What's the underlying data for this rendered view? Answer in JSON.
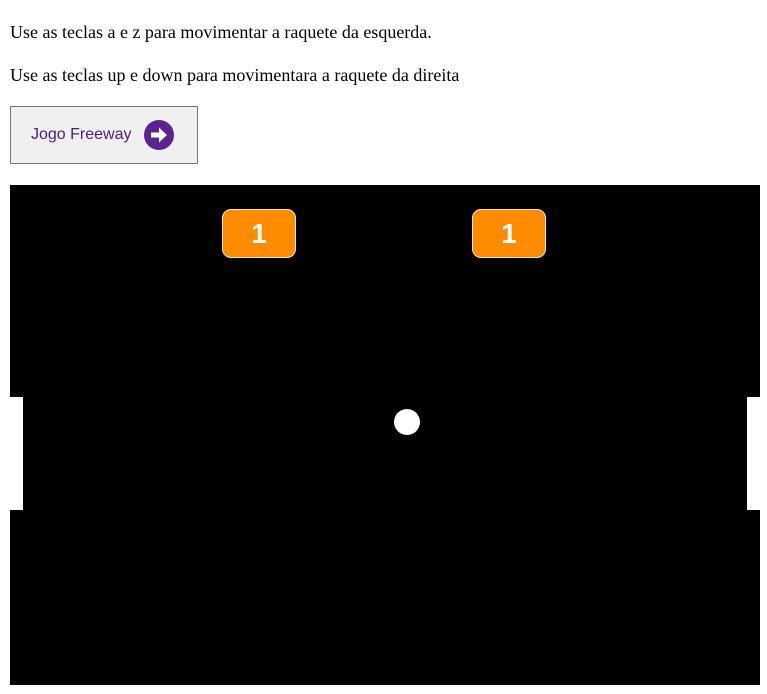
{
  "instructions": {
    "left_paddle": "Use as teclas a e z para movimentar a raquete da esquerda.",
    "right_paddle": "Use as teclas up e down para movimentara a raquete da direita"
  },
  "freeway_button": {
    "label": "Jogo Freeway",
    "icon": "arrow-right-circle-icon",
    "text_color": "#4b1c86",
    "icon_color": "#5b2391"
  },
  "game": {
    "background_color": "#000000",
    "score_badge_color": "#ff8c00",
    "scores": {
      "left": "1",
      "right": "1"
    },
    "paddle_color": "#ffffff",
    "ball_color": "#ffffff"
  }
}
